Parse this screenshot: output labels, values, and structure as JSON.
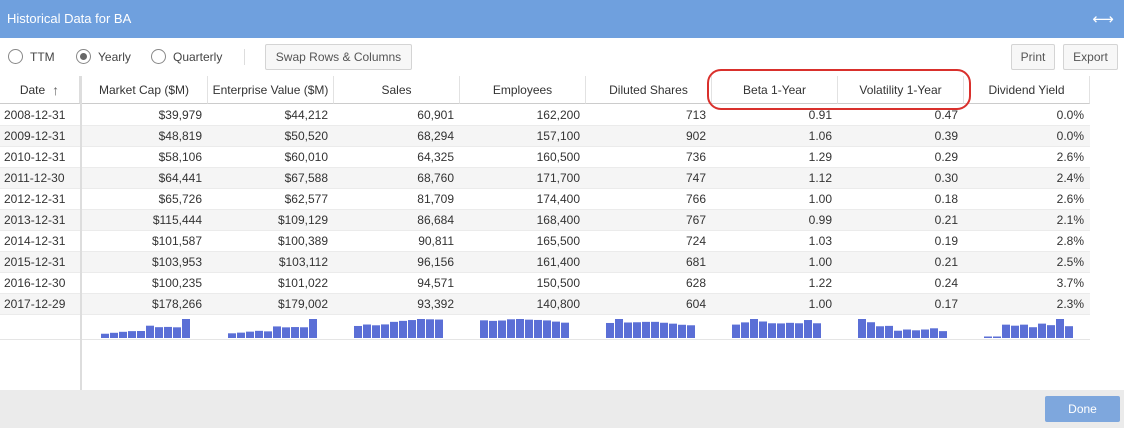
{
  "window": {
    "title": "Historical Data for BA",
    "expand_icon": "horizontal-expand-icon"
  },
  "toolbar": {
    "period_options": [
      {
        "label": "TTM",
        "selected": false
      },
      {
        "label": "Yearly",
        "selected": true
      },
      {
        "label": "Quarterly",
        "selected": false
      }
    ],
    "swap_label": "Swap Rows & Columns",
    "print_label": "Print",
    "export_label": "Export"
  },
  "table": {
    "columns": [
      "Date",
      "Market Cap ($M)",
      "Enterprise Value ($M)",
      "Sales",
      "Employees",
      "Diluted Shares",
      "Beta 1-Year",
      "Volatility 1-Year",
      "Dividend Yield"
    ],
    "sort_icon": "sort-ascending-arrow-icon",
    "rows": [
      [
        "2008-12-31",
        "$39,979",
        "$44,212",
        "60,901",
        "162,200",
        "713",
        "0.91",
        "0.47",
        "0.0%"
      ],
      [
        "2009-12-31",
        "$48,819",
        "$50,520",
        "68,294",
        "157,100",
        "902",
        "1.06",
        "0.39",
        "0.0%"
      ],
      [
        "2010-12-31",
        "$58,106",
        "$60,010",
        "64,325",
        "160,500",
        "736",
        "1.29",
        "0.29",
        "2.6%"
      ],
      [
        "2011-12-30",
        "$64,441",
        "$67,588",
        "68,760",
        "171,700",
        "747",
        "1.12",
        "0.30",
        "2.4%"
      ],
      [
        "2012-12-31",
        "$65,726",
        "$62,577",
        "81,709",
        "174,400",
        "766",
        "1.00",
        "0.18",
        "2.6%"
      ],
      [
        "2013-12-31",
        "$115,444",
        "$109,129",
        "86,684",
        "168,400",
        "767",
        "0.99",
        "0.21",
        "2.1%"
      ],
      [
        "2014-12-31",
        "$101,587",
        "$100,389",
        "90,811",
        "165,500",
        "724",
        "1.03",
        "0.19",
        "2.8%"
      ],
      [
        "2015-12-31",
        "$103,953",
        "$103,112",
        "96,156",
        "161,400",
        "681",
        "1.00",
        "0.21",
        "2.5%"
      ],
      [
        "2016-12-30",
        "$100,235",
        "$101,022",
        "94,571",
        "150,500",
        "628",
        "1.22",
        "0.24",
        "3.7%"
      ],
      [
        "2017-12-29",
        "$178,266",
        "$179,002",
        "93,392",
        "140,800",
        "604",
        "1.00",
        "0.17",
        "2.3%"
      ]
    ]
  },
  "colors": {
    "titlebar": "#6fa0de",
    "sparkline": "#5b6fd6",
    "highlight": "#d9302c",
    "done": "#7ea7dd"
  },
  "footer": {
    "done_label": "Done"
  }
}
